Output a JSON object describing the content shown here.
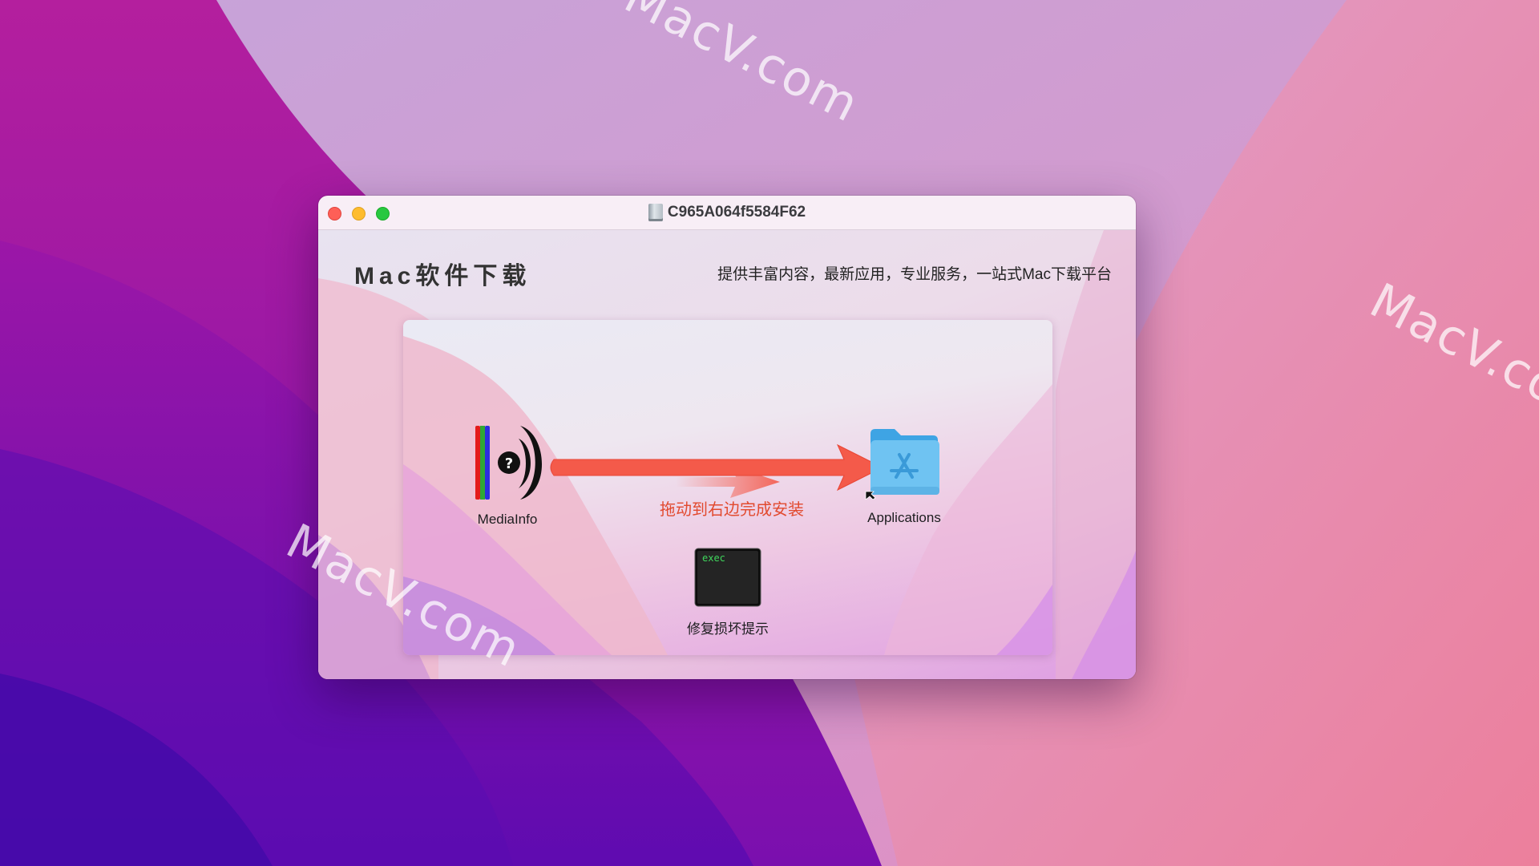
{
  "desktop": {
    "watermarks": [
      "MacV.com",
      "MacV.com",
      "MacV.com"
    ]
  },
  "window": {
    "title": "C965A064f5584F62",
    "title_icon": "drive-icon",
    "controls": {
      "close": "close-button",
      "minimize": "minimize-button",
      "zoom": "zoom-button"
    }
  },
  "header": {
    "brand": "Mac软件下载",
    "tagline": "提供丰富内容，最新应用，专业服务，一站式Mac下载平台"
  },
  "installer": {
    "source_app": {
      "label": "MediaInfo",
      "icon": "mediainfo-icon"
    },
    "target": {
      "label": "Applications",
      "icon": "applications-folder-icon"
    },
    "hint": "拖动到右边完成安装",
    "fix_item": {
      "label": "修复损坏提示",
      "icon_text": "exec",
      "icon": "terminal-exec-icon"
    }
  },
  "colors": {
    "accent_arrow": "#f45a4a",
    "hint_text": "#e24a2f",
    "folder_blue": "#6fc3f2",
    "terminal_green": "#3fd65c"
  }
}
